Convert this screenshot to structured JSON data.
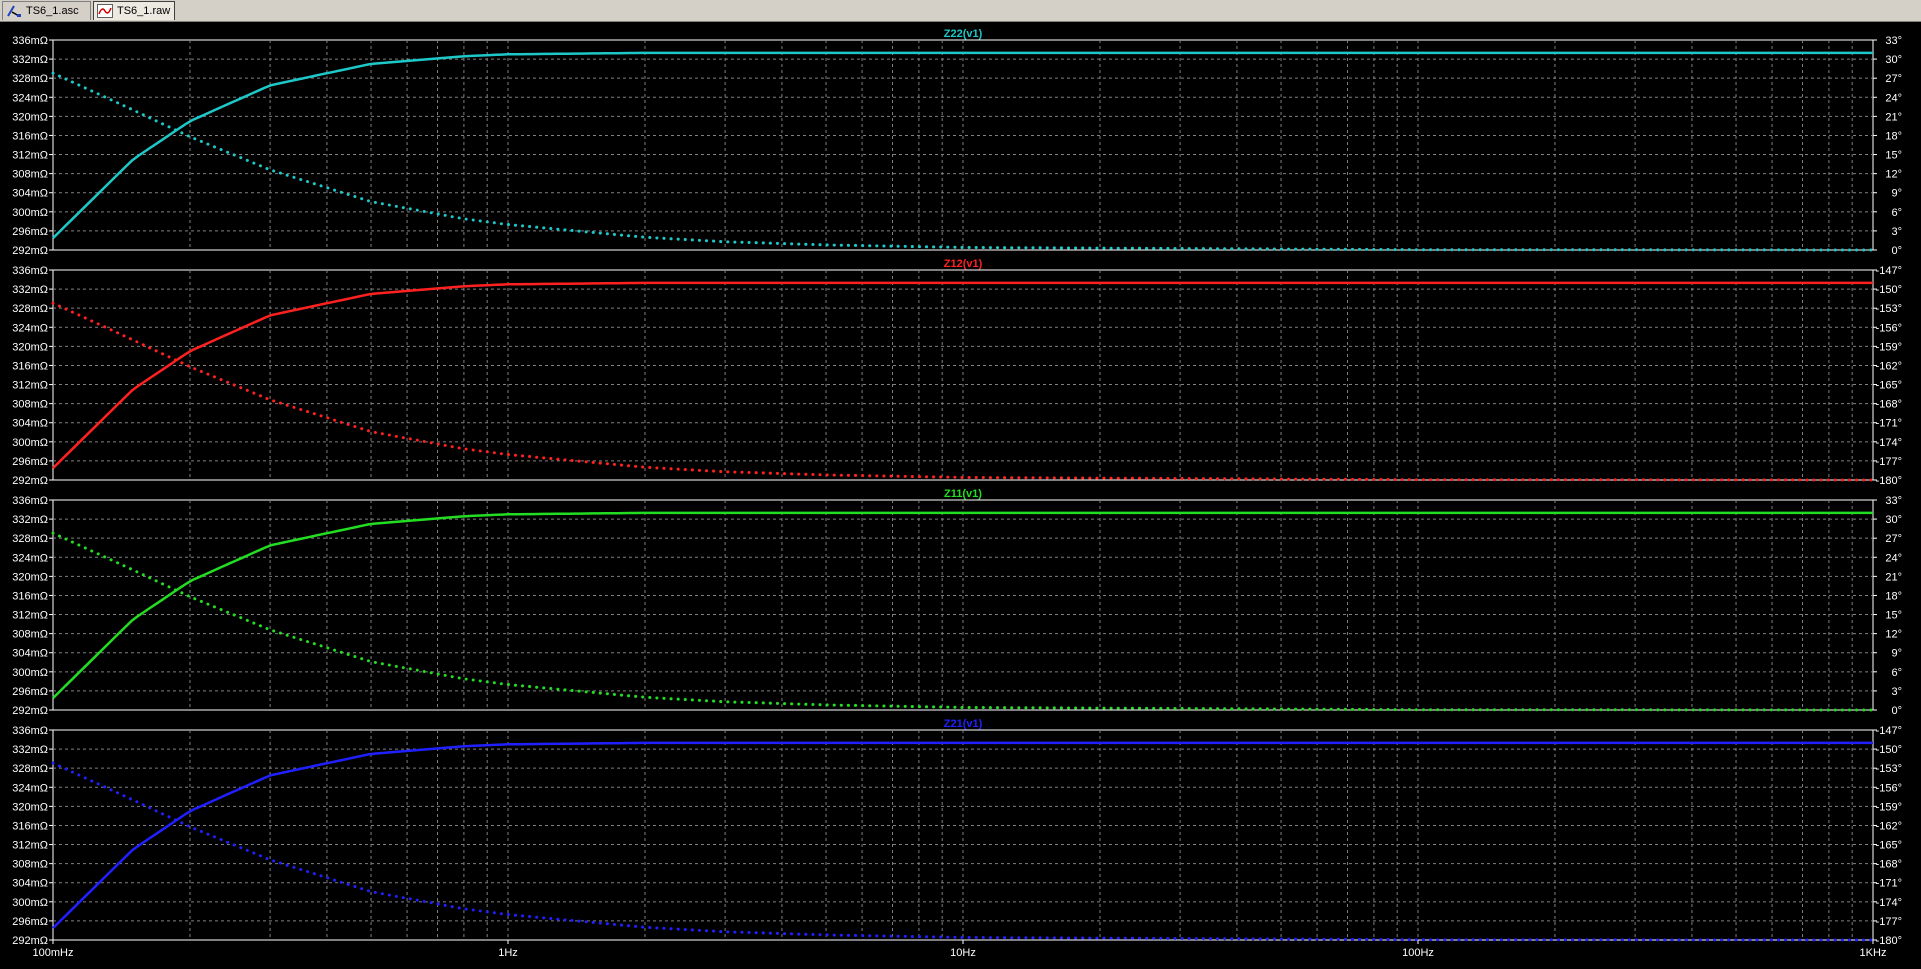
{
  "tabs": [
    {
      "label": "TS6_1.asc",
      "icon": "schematic-icon",
      "active": false
    },
    {
      "label": "TS6_1.raw",
      "icon": "waveform-icon",
      "active": true
    }
  ],
  "chart_data": [
    {
      "type": "line",
      "title": "Z22(v1)",
      "color": "#1ec8c8",
      "xscale": "log",
      "xlim": [
        0.1,
        1000
      ],
      "x_tick_labels": [
        "100mHz",
        "1Hz",
        "10Hz",
        "100Hz",
        "1KHz"
      ],
      "ylim": [
        292,
        336
      ],
      "y_unit": "mΩ",
      "y_ticks": [
        "336mΩ",
        "332mΩ",
        "328mΩ",
        "324mΩ",
        "320mΩ",
        "316mΩ",
        "312mΩ",
        "308mΩ",
        "304mΩ",
        "300mΩ",
        "296mΩ",
        "292mΩ"
      ],
      "y2lim": [
        0,
        33
      ],
      "y2_ticks": [
        "33°",
        "30°",
        "27°",
        "24°",
        "21°",
        "18°",
        "15°",
        "12°",
        "9°",
        "6°",
        "3°",
        "0°"
      ],
      "grid": true,
      "series": [
        {
          "style": "solid",
          "axis": "left",
          "x": [
            0.1,
            0.15,
            0.2,
            0.3,
            0.5,
            0.8,
            1,
            2,
            5,
            10,
            100,
            1000
          ],
          "y": [
            294.5,
            311,
            319,
            326.5,
            331,
            332.6,
            333,
            333.3,
            333.3,
            333.3,
            333.3,
            333.3
          ]
        },
        {
          "style": "dotted",
          "axis": "right",
          "x": [
            0.1,
            0.15,
            0.2,
            0.3,
            0.5,
            0.8,
            1,
            2,
            3,
            5,
            10,
            100,
            1000
          ],
          "y": [
            27.8,
            22,
            17.8,
            12.6,
            7.6,
            4.9,
            4,
            2,
            1.3,
            0.8,
            0.4,
            0.05,
            0
          ]
        }
      ]
    },
    {
      "type": "line",
      "title": "Z12(v1)",
      "color": "#ff2020",
      "xscale": "log",
      "xlim": [
        0.1,
        1000
      ],
      "x_tick_labels": [
        "100mHz",
        "1Hz",
        "10Hz",
        "100Hz",
        "1KHz"
      ],
      "ylim": [
        292,
        336
      ],
      "y_unit": "mΩ",
      "y_ticks": [
        "336mΩ",
        "332mΩ",
        "328mΩ",
        "324mΩ",
        "320mΩ",
        "316mΩ",
        "312mΩ",
        "308mΩ",
        "304mΩ",
        "300mΩ",
        "296mΩ",
        "292mΩ"
      ],
      "y2lim": [
        -180,
        -147
      ],
      "y2_ticks": [
        "-147°",
        "-150°",
        "-153°",
        "-156°",
        "-159°",
        "-162°",
        "-165°",
        "-168°",
        "-171°",
        "-174°",
        "-177°",
        "-180°"
      ],
      "grid": true,
      "series": [
        {
          "style": "solid",
          "axis": "left",
          "x": [
            0.1,
            0.15,
            0.2,
            0.3,
            0.5,
            0.8,
            1,
            2,
            5,
            10,
            100,
            1000
          ],
          "y": [
            294.5,
            311,
            319,
            326.5,
            331,
            332.6,
            333,
            333.3,
            333.3,
            333.3,
            333.3,
            333.3
          ]
        },
        {
          "style": "dotted",
          "axis": "right",
          "x": [
            0.1,
            0.15,
            0.2,
            0.3,
            0.5,
            0.8,
            1,
            2,
            3,
            5,
            10,
            100,
            1000
          ],
          "y": [
            -152.2,
            -158,
            -162.2,
            -167.4,
            -172.4,
            -175.1,
            -176,
            -178,
            -178.7,
            -179.2,
            -179.6,
            -179.95,
            -180
          ]
        }
      ]
    },
    {
      "type": "line",
      "title": "Z11(v1)",
      "color": "#22dd22",
      "xscale": "log",
      "xlim": [
        0.1,
        1000
      ],
      "x_tick_labels": [
        "100mHz",
        "1Hz",
        "10Hz",
        "100Hz",
        "1KHz"
      ],
      "ylim": [
        292,
        336
      ],
      "y_unit": "mΩ",
      "y_ticks": [
        "336mΩ",
        "332mΩ",
        "328mΩ",
        "324mΩ",
        "320mΩ",
        "316mΩ",
        "312mΩ",
        "308mΩ",
        "304mΩ",
        "300mΩ",
        "296mΩ",
        "292mΩ"
      ],
      "y2lim": [
        0,
        33
      ],
      "y2_ticks": [
        "33°",
        "30°",
        "27°",
        "24°",
        "21°",
        "18°",
        "15°",
        "12°",
        "9°",
        "6°",
        "3°",
        "0°"
      ],
      "grid": true,
      "series": [
        {
          "style": "solid",
          "axis": "left",
          "x": [
            0.1,
            0.15,
            0.2,
            0.3,
            0.5,
            0.8,
            1,
            2,
            5,
            10,
            100,
            1000
          ],
          "y": [
            294.5,
            311,
            319,
            326.5,
            331,
            332.6,
            333,
            333.3,
            333.3,
            333.3,
            333.3,
            333.3
          ]
        },
        {
          "style": "dotted",
          "axis": "right",
          "x": [
            0.1,
            0.15,
            0.2,
            0.3,
            0.5,
            0.8,
            1,
            2,
            3,
            5,
            10,
            100,
            1000
          ],
          "y": [
            27.8,
            22,
            17.8,
            12.6,
            7.6,
            4.9,
            4,
            2,
            1.3,
            0.8,
            0.4,
            0.05,
            0
          ]
        }
      ]
    },
    {
      "type": "line",
      "title": "Z21(v1)",
      "color": "#2020ff",
      "xscale": "log",
      "xlim": [
        0.1,
        1000
      ],
      "x_tick_labels": [
        "100mHz",
        "1Hz",
        "10Hz",
        "100Hz",
        "1KHz"
      ],
      "ylim": [
        292,
        336
      ],
      "y_unit": "mΩ",
      "y_ticks": [
        "336mΩ",
        "332mΩ",
        "328mΩ",
        "324mΩ",
        "320mΩ",
        "316mΩ",
        "312mΩ",
        "308mΩ",
        "304mΩ",
        "300mΩ",
        "296mΩ",
        "292mΩ"
      ],
      "y2lim": [
        -180,
        -147
      ],
      "y2_ticks": [
        "-147°",
        "-150°",
        "-153°",
        "-156°",
        "-159°",
        "-162°",
        "-165°",
        "-168°",
        "-171°",
        "-174°",
        "-177°",
        "-180°"
      ],
      "grid": true,
      "series": [
        {
          "style": "solid",
          "axis": "left",
          "x": [
            0.1,
            0.15,
            0.2,
            0.3,
            0.5,
            0.8,
            1,
            2,
            5,
            10,
            100,
            1000
          ],
          "y": [
            294.5,
            311,
            319,
            326.5,
            331,
            332.6,
            333,
            333.3,
            333.3,
            333.3,
            333.3,
            333.3
          ]
        },
        {
          "style": "dotted",
          "axis": "right",
          "x": [
            0.1,
            0.15,
            0.2,
            0.3,
            0.5,
            0.8,
            1,
            2,
            3,
            5,
            10,
            100,
            1000
          ],
          "y": [
            -152.2,
            -158,
            -162.2,
            -167.4,
            -172.4,
            -175.1,
            -176,
            -178,
            -178.7,
            -179.2,
            -179.6,
            -179.95,
            -180
          ]
        }
      ]
    }
  ]
}
